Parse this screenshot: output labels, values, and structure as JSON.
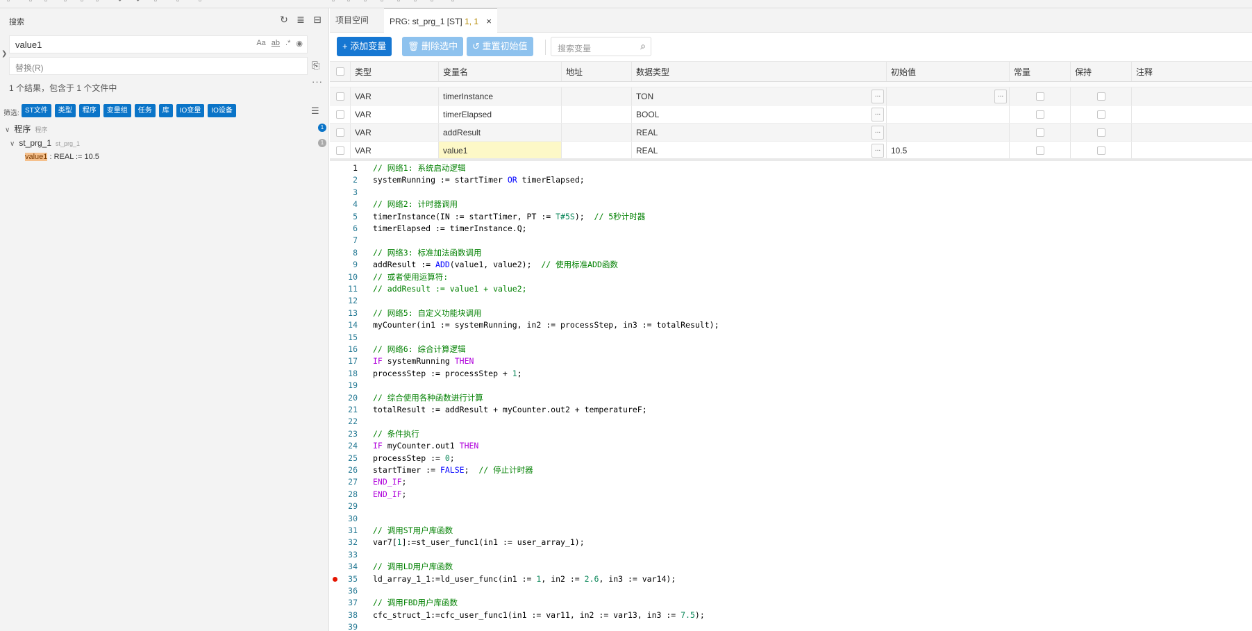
{
  "search_panel": {
    "title": "搜索",
    "query": "value1",
    "options": [
      "Aa",
      "ab",
      ".*"
    ],
    "replace_placeholder": "替换(R)",
    "summary": "1 个结果，包含于 1 个文件中",
    "filter_label": "筛选:",
    "filters": [
      "ST文件",
      "类型",
      "程序",
      "变量组",
      "任务",
      "库",
      "IO变量",
      "IO设备"
    ],
    "tree": {
      "group_label": "程序",
      "group_sub": "程序",
      "group_count": "1",
      "file_label": "st_prg_1",
      "file_sub": "st_prg_1",
      "file_count": "1",
      "match_hit": "value1",
      "match_rest": " : REAL := 10.5"
    }
  },
  "tabs": [
    {
      "label": "项目空间"
    },
    {
      "label": "PRG: st_prg_1 [ST]",
      "pos": "1, 1",
      "close": "×"
    }
  ],
  "toolbar": {
    "add_var": "+ 添加变量",
    "delete_selected": "删除选中",
    "reset_initial": "重置初始值",
    "search_placeholder": "搜索变量"
  },
  "table": {
    "headers": [
      "类型",
      "变量名",
      "地址",
      "数据类型",
      "初始值",
      "常量",
      "保持",
      "注释"
    ],
    "rows": [
      {
        "kind": "VAR",
        "name": "timerInstance",
        "addr": "",
        "dtype": "TON",
        "init": ""
      },
      {
        "kind": "VAR",
        "name": "timerElapsed",
        "addr": "",
        "dtype": "BOOL",
        "init": ""
      },
      {
        "kind": "VAR",
        "name": "addResult",
        "addr": "",
        "dtype": "REAL",
        "init": ""
      },
      {
        "kind": "VAR",
        "name": "value1",
        "addr": "",
        "dtype": "REAL",
        "init": "10.5"
      }
    ],
    "ellipsis": "..."
  },
  "code_lines": [
    "// 网络1: 系统启动逻辑",
    "systemRunning := startTimer OR timerElapsed;",
    "",
    "// 网络2: 计时器调用",
    "timerInstance(IN := startTimer, PT := T#5S);  // 5秒计时器",
    "timerElapsed := timerInstance.Q;",
    "",
    "// 网络3: 标准加法函数调用",
    "addResult := ADD(value1, value2);  // 使用标准ADD函数",
    "// 或者使用运算符:",
    "// addResult := value1 + value2;",
    "",
    "// 网络5: 自定义功能块调用",
    "myCounter(in1 := systemRunning, in2 := processStep, in3 := totalResult);",
    "",
    "// 网络6: 综合计算逻辑",
    "IF systemRunning THEN",
    "processStep := processStep + 1;",
    "",
    "// 综合使用各种函数进行计算",
    "totalResult := addResult + myCounter.out2 + temperatureF;",
    "",
    "// 条件执行",
    "IF myCounter.out1 THEN",
    "processStep := 0;",
    "startTimer := FALSE;  // 停止计时器",
    "END_IF;",
    "END_IF;",
    "",
    "",
    "// 调用ST用户库函数",
    "var7[1]:=st_user_func1(in1 := user_array_1);",
    "",
    "// 调用LD用户库函数",
    "ld_array_1_1:=ld_user_func(in1 := 1, in2 := 2.6, in3 := var14);",
    "",
    "// 调用FBD用户库函数",
    "cfc_struct_1:=cfc_user_func1(in1 := var11, in2 := var13, in3 := 7.5);",
    ""
  ],
  "breakpoint_line": 35,
  "colors": {
    "accent": "#1677d2",
    "accent_disabled": "#8ec2ee",
    "chip": "#0a74c8",
    "comment": "#008000",
    "keyword": "#af00db",
    "number": "#098658",
    "breakpoint": "#e51400",
    "highlight_cell": "#fdf8c7"
  }
}
